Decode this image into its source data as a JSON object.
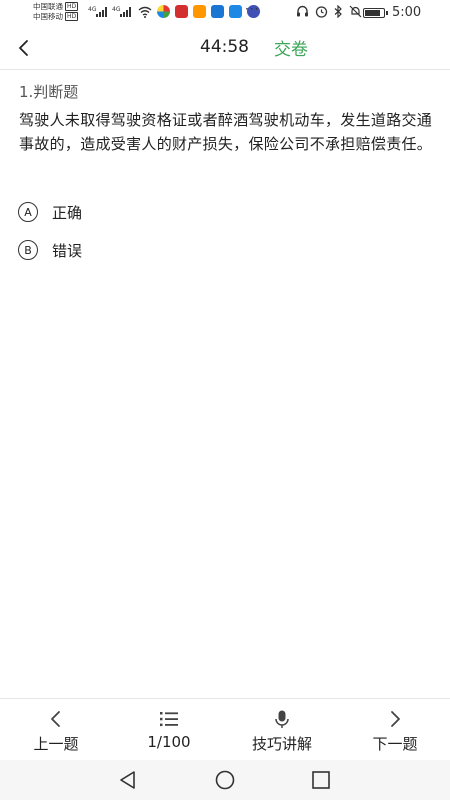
{
  "status_bar": {
    "carrier1": "中国联通",
    "carrier2": "中国移动",
    "hd": "HD",
    "net1": "4G",
    "net2": "4G",
    "more": "···",
    "time": "5:00"
  },
  "header": {
    "timer": "44:58",
    "submit_label": "交卷"
  },
  "question": {
    "type_label": "1.判断题",
    "text": "驾驶人未取得驾驶资格证或者醉酒驾驶机动车，发生道路交通事故的，造成受害人的财产损失，保险公司不承担赔偿责任。",
    "options": [
      {
        "letter": "A",
        "text": "正确"
      },
      {
        "letter": "B",
        "text": "错误"
      }
    ]
  },
  "bottom_nav": {
    "prev_label": "上一题",
    "progress_label": "1/100",
    "tips_label": "技巧讲解",
    "next_label": "下一题"
  },
  "colors": {
    "accent": "#3aa657",
    "text": "#222222",
    "divider": "#e6e6e6"
  }
}
